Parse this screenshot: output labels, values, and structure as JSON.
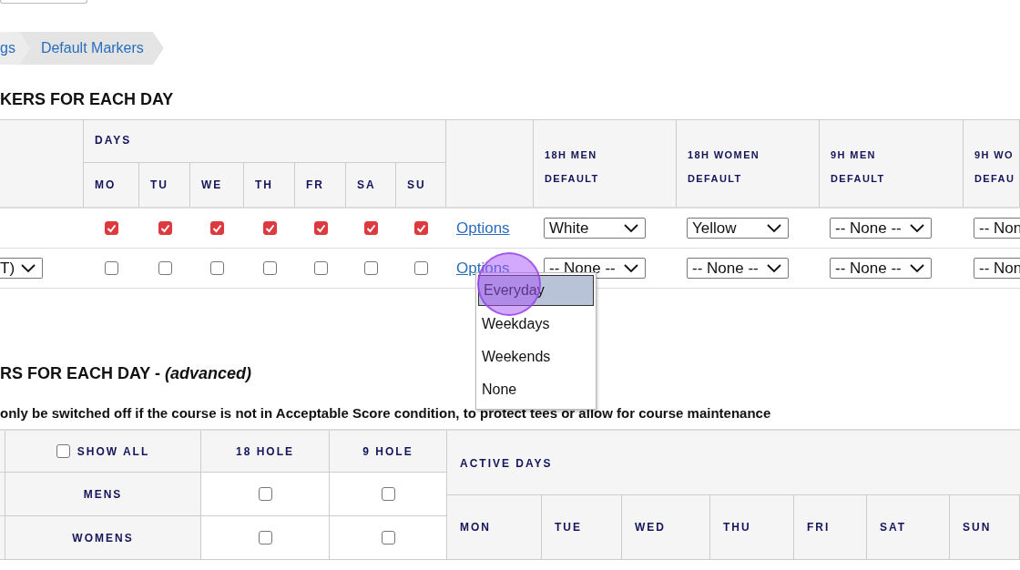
{
  "breadcrumbs": [
    {
      "label": "gs"
    },
    {
      "label": "Default Markers"
    }
  ],
  "section_1": {
    "heading": "KERS FOR EACH DAY",
    "table": {
      "group_header": "DAYS",
      "days": [
        "MO",
        "TU",
        "WE",
        "TH",
        "FR",
        "SA",
        "SU"
      ],
      "marker_columns": [
        {
          "lines": [
            "18H MEN",
            "DEFAULT"
          ]
        },
        {
          "lines": [
            "18H WOMEN",
            "DEFAULT"
          ]
        },
        {
          "lines": [
            "9H MEN",
            "DEFAULT"
          ]
        },
        {
          "lines": [
            "9H WO",
            "DEFAU"
          ]
        }
      ],
      "rows": [
        {
          "days": [
            true,
            true,
            true,
            true,
            true,
            true,
            true
          ],
          "link": "Options",
          "markers": [
            "White",
            "Yellow",
            "-- None --",
            "-- Non"
          ]
        },
        {
          "select": "T)",
          "days": [
            false,
            false,
            false,
            false,
            false,
            false,
            false
          ],
          "link": "Options",
          "markers": [
            "-- None --",
            "-- None --",
            "-- None --",
            "-- Non"
          ]
        }
      ]
    }
  },
  "options_menu": {
    "items": [
      {
        "label": "Everyday",
        "selected": true
      },
      {
        "label": "Weekdays",
        "selected": false
      },
      {
        "label": "Weekends",
        "selected": false
      },
      {
        "label": "None",
        "selected": false
      }
    ]
  },
  "section_2": {
    "heading": "RS FOR EACH DAY - *(advanced)*",
    "note": "only be switched off if the course is not in Acceptable Score condition, to protect tees or allow for course maintenance",
    "table": {
      "show_all": {
        "label": "SHOW ALL",
        "checked": false
      },
      "columns": [
        "18 HOLE",
        "9 HOLE"
      ],
      "rows": [
        {
          "label": "MENS",
          "checks": [
            false,
            false
          ]
        },
        {
          "label": "WOMENS",
          "checks": [
            false,
            false
          ]
        }
      ],
      "active_days_header": "ACTIVE DAYS",
      "days": [
        "MON",
        "TUE",
        "WED",
        "THU",
        "FRI",
        "SAT",
        "SUN"
      ]
    }
  }
}
